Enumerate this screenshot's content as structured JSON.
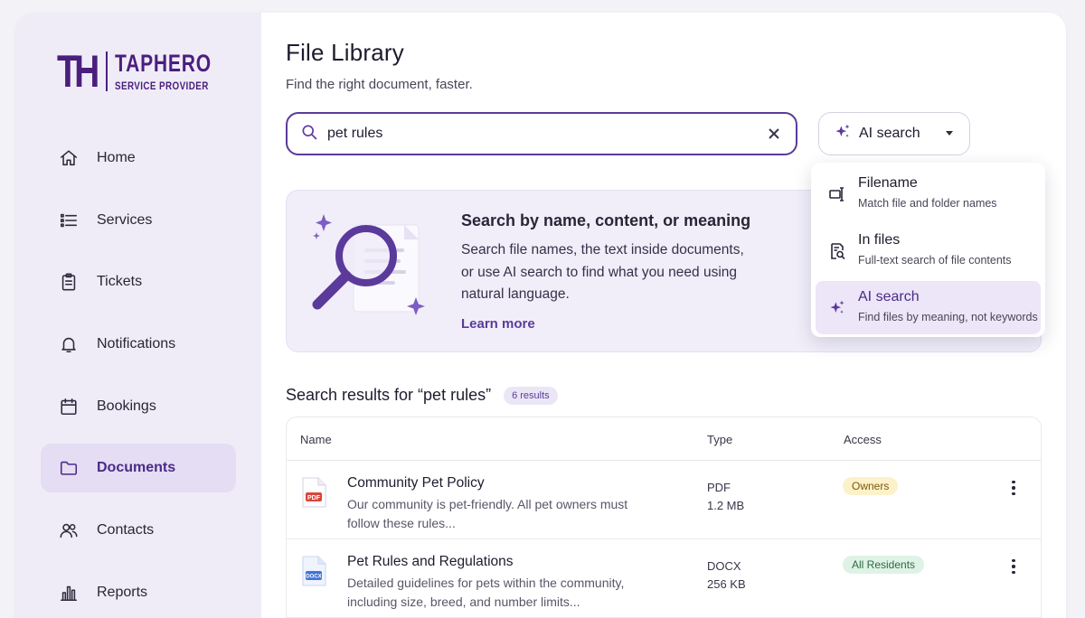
{
  "brand": {
    "mark": "TH",
    "name": "TAPHERO",
    "tagline": "SERVICE PROVIDER",
    "color": "#4b1e7e"
  },
  "sidebar": {
    "items": [
      {
        "label": "Home",
        "icon": "home-icon",
        "active": false
      },
      {
        "label": "Services",
        "icon": "list-icon",
        "active": false
      },
      {
        "label": "Tickets",
        "icon": "clipboard-icon",
        "active": false
      },
      {
        "label": "Notifications",
        "icon": "bell-icon",
        "active": false
      },
      {
        "label": "Bookings",
        "icon": "calendar-icon",
        "active": false
      },
      {
        "label": "Documents",
        "icon": "folder-icon",
        "active": true
      },
      {
        "label": "Contacts",
        "icon": "users-icon",
        "active": false
      },
      {
        "label": "Reports",
        "icon": "bar-chart-icon",
        "active": false
      }
    ]
  },
  "header": {
    "title": "File Library",
    "subtitle": "Find the right document, faster."
  },
  "search": {
    "value": "pet rules",
    "placeholder": "",
    "mode_label": "AI search"
  },
  "info_card": {
    "title": "Search by name, content, or meaning",
    "body": "Search file names, the text inside documents, or use AI search to find what you need using natural language.",
    "link": "Learn more"
  },
  "search_modes": [
    {
      "title": "Filename",
      "desc": "Match file and folder names",
      "icon": "filename-icon",
      "selected": false
    },
    {
      "title": "In files",
      "desc": "Full-text search of file contents",
      "icon": "text-search-icon",
      "selected": false
    },
    {
      "title": "AI search",
      "desc": "Find files by meaning, not keywords",
      "icon": "sparkle-icon",
      "selected": true
    }
  ],
  "results": {
    "heading": "Search results for “pet rules”",
    "count": "6 results",
    "columns": [
      "Name",
      "Type",
      "Access"
    ],
    "rows": [
      {
        "name": "Community Pet Policy",
        "desc": "Our community is pet-friendly. All pet owners must follow these rules...",
        "type": "PDF",
        "size": "1.2 MB",
        "access": "Owners",
        "file_icon": "pdf-file-icon"
      },
      {
        "name": "Pet Rules and Regulations",
        "desc": "Detailed guidelines for pets within the community, including size, breed, and number limits...",
        "type": "DOCX",
        "size": "256 KB",
        "access": "All Residents",
        "file_icon": "docx-file-icon"
      }
    ]
  },
  "colors": {
    "accent": "#5b3a9b",
    "sidebar_bg": "#efecf7",
    "active_bg": "#e4ddf3",
    "pdf": "#d9453b",
    "docx": "#3f74d9"
  }
}
